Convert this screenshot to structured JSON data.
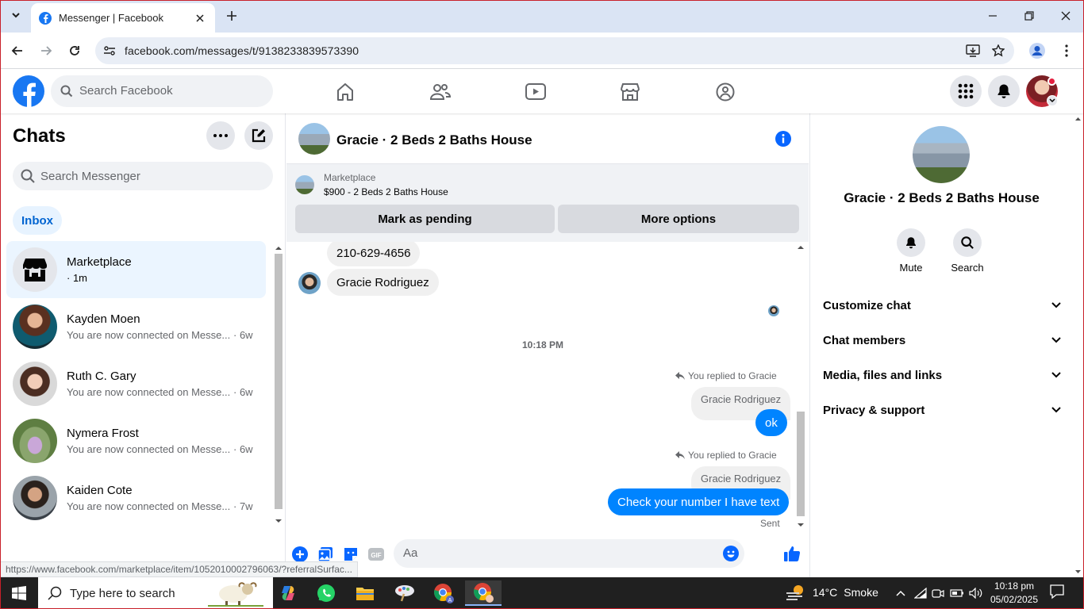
{
  "browser": {
    "tab_title": "Messenger | Facebook",
    "url": "facebook.com/messages/t/9138233839573390",
    "status_url": "https://www.facebook.com/marketplace/item/1052010002796063/?referralSurfac..."
  },
  "header": {
    "search_placeholder": "Search Facebook"
  },
  "sidebar": {
    "title": "Chats",
    "search_placeholder": "Search Messenger",
    "filter": "Inbox",
    "chats": [
      {
        "name": "Marketplace",
        "preview": "",
        "time": "· 1m"
      },
      {
        "name": "Kayden Moen",
        "preview": "You are now connected on Messe...",
        "time": "· 6w"
      },
      {
        "name": "Ruth C. Gary",
        "preview": "You are now connected on Messe...",
        "time": "· 6w"
      },
      {
        "name": "Nymera Frost",
        "preview": "You are now connected on Messe...",
        "time": "· 6w"
      },
      {
        "name": "Kaiden Cote",
        "preview": "You are now connected on Messe...",
        "time": "· 7w"
      }
    ]
  },
  "conversation": {
    "title": "Gracie · 2 Beds 2 Baths House",
    "marketplace_label": "Marketplace",
    "listing": "$900 - 2 Beds 2 Baths House",
    "btn_pending": "Mark as pending",
    "btn_more": "More options",
    "messages": {
      "phone": "210-629-4656",
      "name_msg": "Gracie Rodriguez",
      "timestamp": "10:18 PM",
      "replied_1": "You replied to Gracie",
      "quoted_1": "Gracie Rodriguez",
      "reply_1": "ok",
      "replied_2": "You replied to Gracie",
      "quoted_2": "Gracie Rodriguez",
      "reply_2": "Check your number I have text",
      "sent": "Sent"
    },
    "composer_placeholder": "Aa"
  },
  "details": {
    "name": "Gracie · 2 Beds 2 Baths House",
    "actions": [
      "Mute",
      "Search"
    ],
    "sections": [
      "Customize chat",
      "Chat members",
      "Media, files and links",
      "Privacy & support"
    ]
  },
  "taskbar": {
    "search_placeholder": "Type here to search",
    "weather_temp": "14°C",
    "weather_desc": "Smoke",
    "time": "10:18 pm",
    "date": "05/02/2025"
  },
  "colors": {
    "fb_blue": "#1877f2",
    "messenger_blue": "#0084ff"
  }
}
